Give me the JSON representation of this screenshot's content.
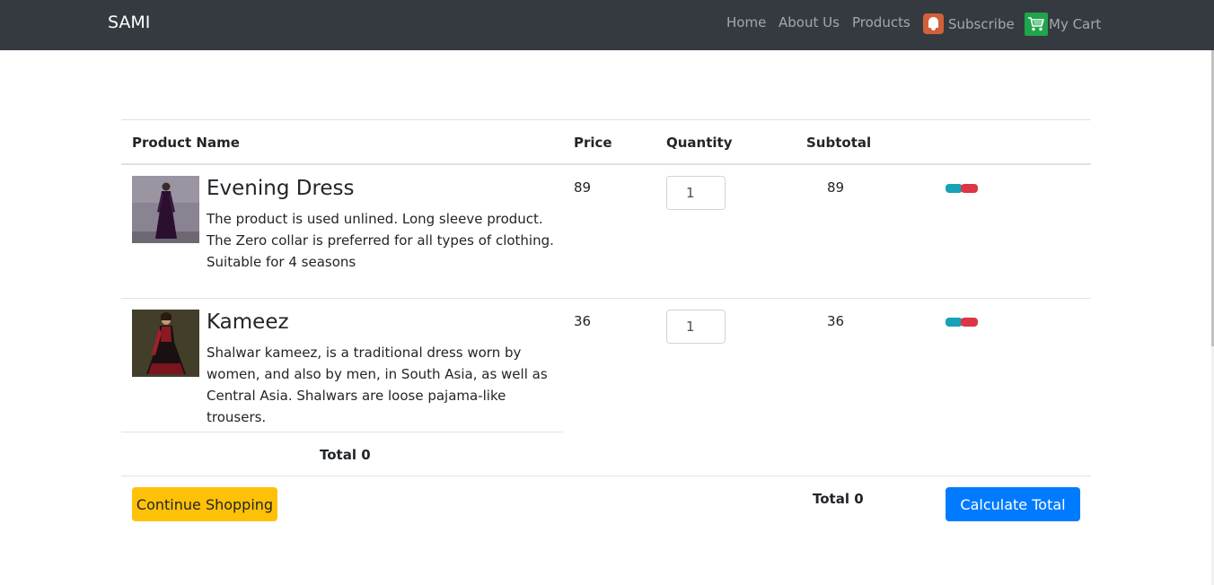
{
  "navbar": {
    "brand": "SAMI",
    "links": {
      "home": "Home",
      "about": "About Us",
      "products": "Products",
      "subscribe": "Subscribe",
      "cart": "My Cart"
    }
  },
  "table": {
    "headers": {
      "product_name": "Product Name",
      "price": "Price",
      "quantity": "Quantity",
      "subtotal": "Subtotal"
    },
    "rows": [
      {
        "name": "Evening Dress",
        "description": "The product is used unlined. Long sleeve product. The Zero collar is preferred for all types of clothing. Suitable for 4 seasons",
        "price": "89",
        "quantity": "1",
        "subtotal": "89"
      },
      {
        "name": "Kameez",
        "description": "Shalwar kameez, is a traditional dress worn by women, and also by men, in South Asia, as well as Central Asia. Shalwars are loose pajama-like trousers.",
        "price": "36",
        "quantity": "1",
        "subtotal": "36"
      }
    ]
  },
  "totals": {
    "left_total": "Total 0",
    "right_total": "Total 0"
  },
  "buttons": {
    "continue_shopping": "Continue Shopping",
    "calculate_total": "Calculate Total"
  },
  "colors": {
    "navbar_bg": "#343a40",
    "warning": "#ffc107",
    "primary": "#007bff",
    "info": "#17a2b8",
    "danger": "#dc3545",
    "subscribe_icon": "#d2603a",
    "cart_icon": "#1fa54a"
  },
  "icons": {
    "subscribe": "bell-icon",
    "cart": "shopping-cart-icon"
  }
}
